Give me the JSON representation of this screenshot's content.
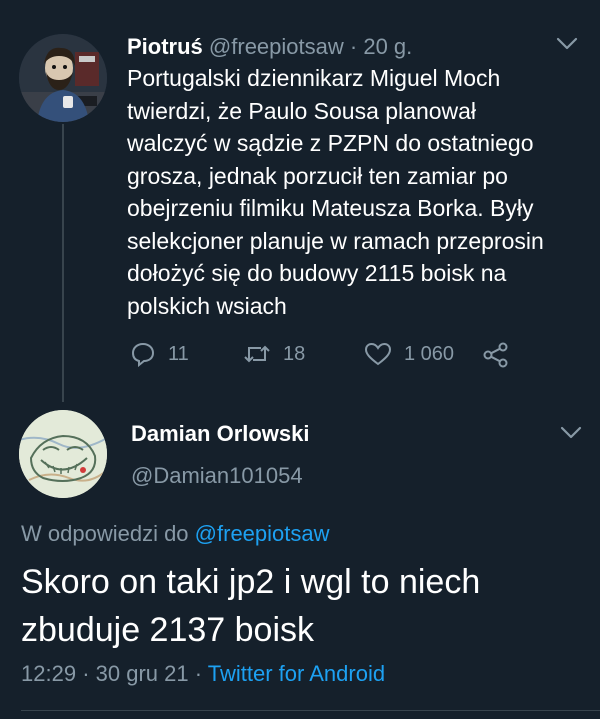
{
  "tweet1": {
    "author_name": "Piotruś",
    "handle": "@freepiotsaw",
    "separator": "·",
    "time": "20 g.",
    "body_lines": [
      "Portugalski dziennikarz Miguel Moch",
      "twierdzi, że Paulo Sousa planował",
      "walczyć w sądzie z PZPN do ostatniego",
      "grosza, jednak porzucił ten zamiar po",
      "obejrzeniu filmiku Mateusza Borka. Były",
      "selekcjoner planuje w ramach przeprosin",
      "dołożyć się do budowy 2115 boisk na",
      "polskich wsiach"
    ],
    "actions": {
      "replies": "11",
      "retweets": "18",
      "likes": "1 060"
    }
  },
  "tweet2": {
    "author_name": "Damian Orlowski",
    "handle": "@Damian101054",
    "reply_prefix": "W odpowiedzi do",
    "reply_to": "@freepiotsaw",
    "body_lines": [
      "Skoro on taki jp2 i wgl to niech",
      "zbuduje 2137 boisk"
    ],
    "time": "12:29",
    "date": "30 gru 21",
    "source": "Twitter for Android",
    "separator": "·"
  },
  "colors": {
    "background": "#15202b",
    "muted": "#8899a6",
    "link": "#1da1f2",
    "text": "#ffffff",
    "divider": "#38444d"
  },
  "icons": [
    "reply-icon",
    "retweet-icon",
    "like-icon",
    "share-icon",
    "chevron-down-icon"
  ]
}
